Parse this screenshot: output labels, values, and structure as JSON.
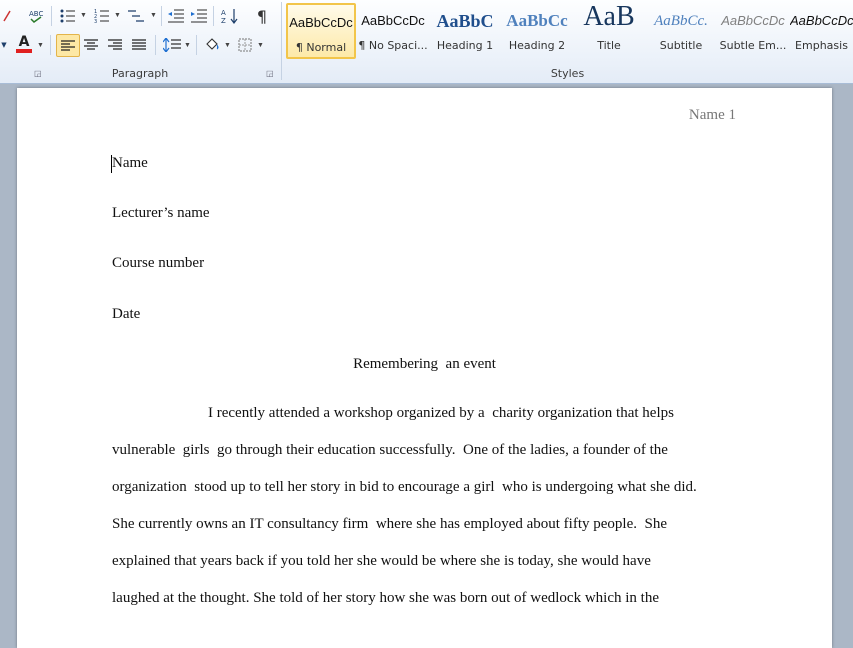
{
  "ribbon": {
    "paragraph_group_label": "Paragraph",
    "styles_group_label": "Styles",
    "styles": [
      {
        "sample": "AaBbCcDc",
        "name": "¶ Normal",
        "selected": true
      },
      {
        "sample": "AaBbCcDc",
        "name": "¶ No Spaci..."
      },
      {
        "sample": "AaBbC",
        "name": "Heading 1"
      },
      {
        "sample": "AaBbCc",
        "name": "Heading 2"
      },
      {
        "sample": "AaB",
        "name": "Title"
      },
      {
        "sample": "AaBbCc.",
        "name": "Subtitle"
      },
      {
        "sample": "AaBbCcDc",
        "name": "Subtle Em..."
      },
      {
        "sample": "AaBbCcDc",
        "name": "Emphasis"
      }
    ],
    "icons": {
      "font_color_glyph": "A",
      "pilcrow": "¶"
    },
    "colors": {
      "font_color_underline": "#e02020",
      "accent": "#f2c54a"
    }
  },
  "document": {
    "header": "Name 1",
    "lines": [
      "Name",
      "Lecturer’s name",
      "Course number",
      "Date"
    ],
    "title": "Remembering  an event",
    "body": [
      "I recently attended a workshop organized by a  charity organization that helps",
      "vulnerable  girls  go through their education successfully.  One of the ladies, a founder of the",
      "organization  stood up to tell her story in bid to encourage a girl  who is undergoing what she did.",
      "She currently owns an IT consultancy firm  where she has employed about fifty people.  She",
      "explained that years back if you told her she would be where she is today, she would have",
      "laughed at the thought. She told of her story how she was born out of wedlock which in the"
    ]
  }
}
